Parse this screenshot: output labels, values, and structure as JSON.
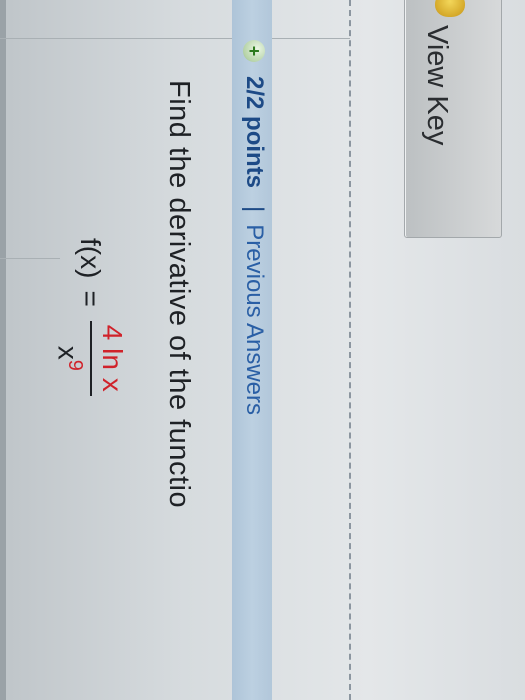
{
  "toolbar": {
    "view_key_label": "View Key",
    "key_icon": "key-icon"
  },
  "question_header": {
    "status_icon": "plus-circle-icon",
    "points": "2/2 points",
    "separator": "|",
    "previous_answers": "Previous Answers"
  },
  "question": {
    "prompt": "Find the derivative of the functio",
    "formula": {
      "lhs": "f(x)",
      "equals": "=",
      "numerator": "4 ln x",
      "denominator_base": "x",
      "denominator_exponent": "9"
    }
  },
  "colors": {
    "header_band": "#b8cde0",
    "link_blue": "#2a5fa5",
    "answer_red": "#d0222a",
    "text": "#1e2125"
  }
}
